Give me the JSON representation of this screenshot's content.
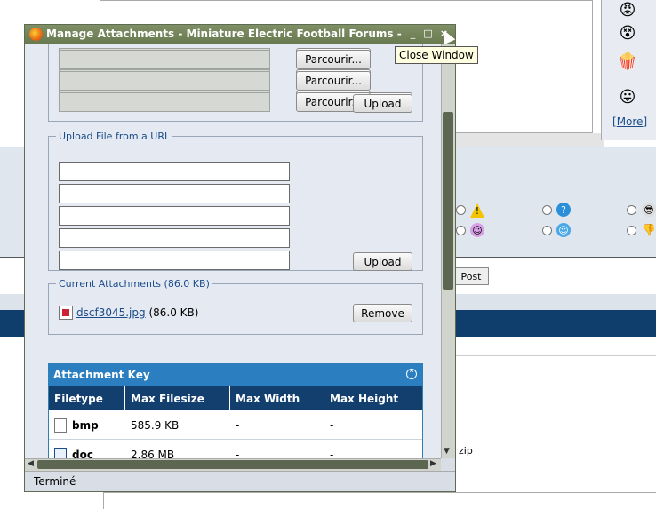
{
  "background": {
    "more_link": "More",
    "post_button": "Post",
    "zip_text": "zip"
  },
  "window": {
    "title": "Manage Attachments - Miniature Electric Football Forums - Mozilla Firefox",
    "status": "Terminé",
    "tooltip": "Close Window"
  },
  "upload_local": {
    "browse_label": "Parcourir...",
    "upload_label": "Upload"
  },
  "upload_url": {
    "legend": "Upload File from a URL",
    "upload_label": "Upload"
  },
  "current": {
    "legend": "Current Attachments (86.0 KB)",
    "file_name": "dscf3045.jpg",
    "file_size": "(86.0 KB)",
    "remove_label": "Remove"
  },
  "attachment_key": {
    "title": "Attachment Key",
    "columns": [
      "Filetype",
      "Max Filesize",
      "Max Width",
      "Max Height"
    ],
    "rows": [
      {
        "type": "bmp",
        "size": "585.9 KB",
        "width": "-",
        "height": "-"
      },
      {
        "type": "doc",
        "size": "2.86 MB",
        "width": "-",
        "height": "-"
      }
    ]
  }
}
